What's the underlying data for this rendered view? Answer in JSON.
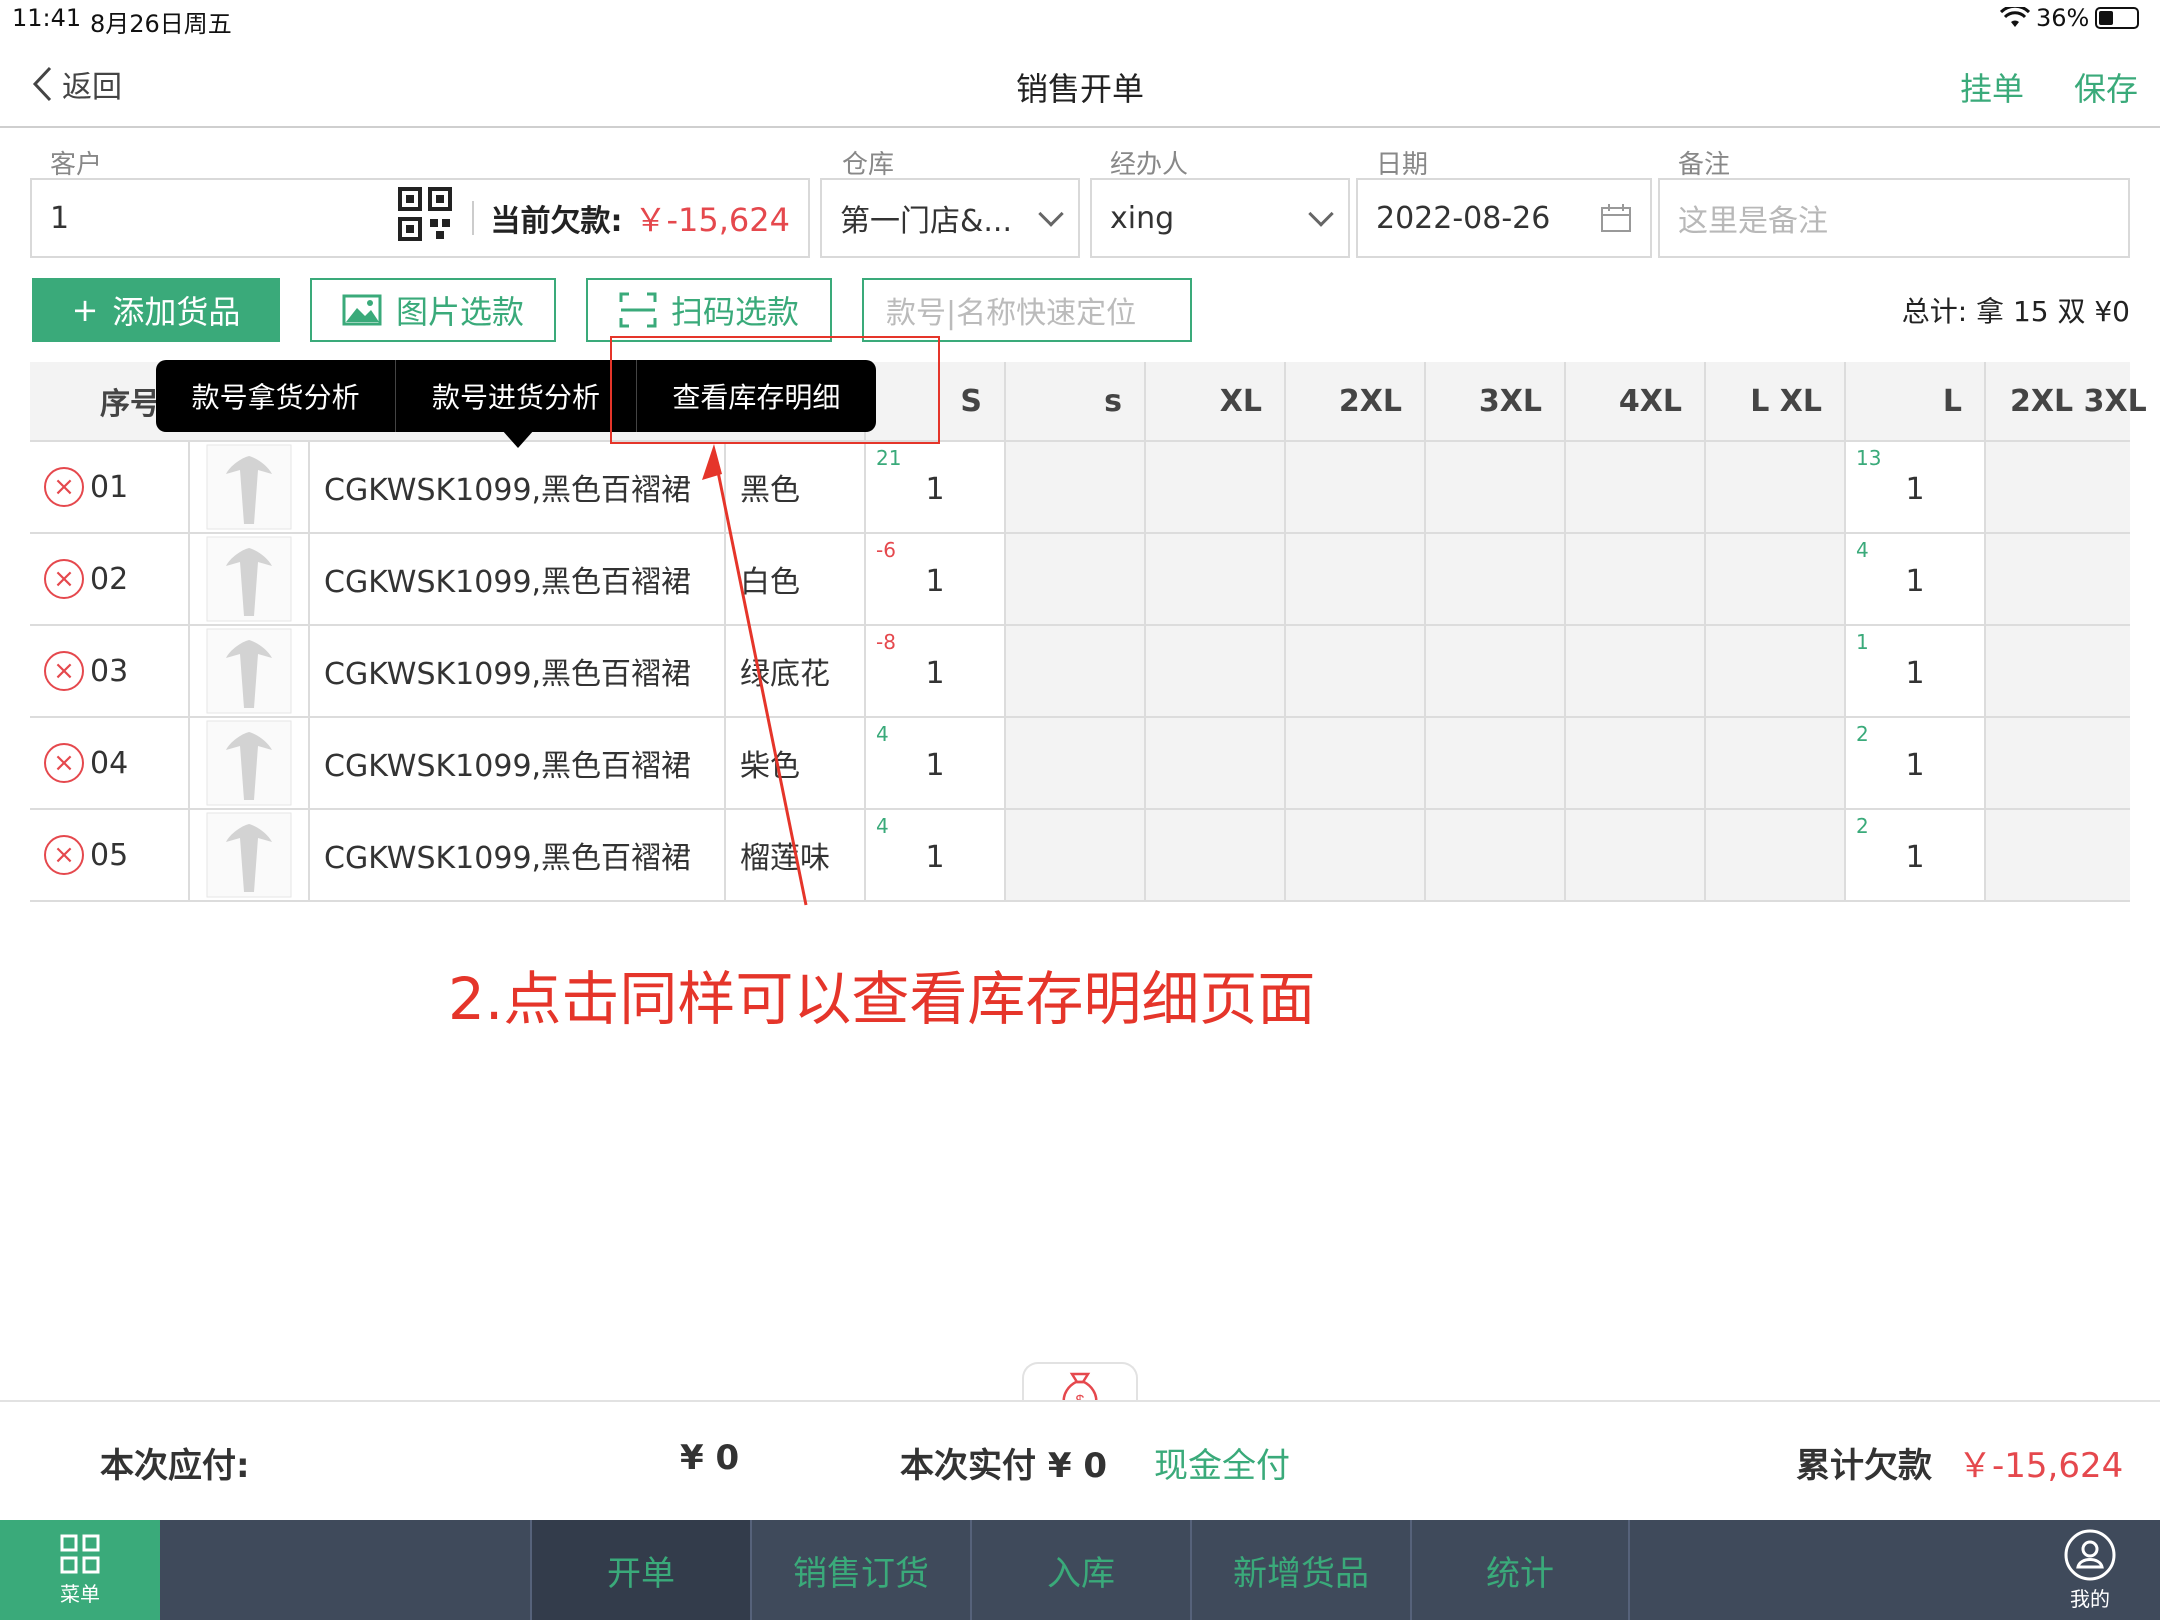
{
  "status_bar": {
    "time": "11:41",
    "date": "8月26日周五",
    "battery": "36%"
  },
  "nav": {
    "back_label": "返回",
    "title": "销售开单",
    "hold_label": "挂单",
    "save_label": "保存"
  },
  "form": {
    "customer_label": "客户",
    "customer_value": "1",
    "debt_label": "当前欠款:",
    "debt_value": "￥-15,624",
    "warehouse_label": "仓库",
    "warehouse_value": "第一门店&...",
    "handler_label": "经办人",
    "handler_value": "xing",
    "date_label": "日期",
    "date_value": "2022-08-26",
    "remark_label": "备注",
    "remark_placeholder": "这里是备注"
  },
  "actions": {
    "add_goods": "添加货品",
    "image_select": "图片选款",
    "scan_select": "扫码选款",
    "search_placeholder": "款号|名称快速定位",
    "total": "总计: 拿 15 双 ¥0"
  },
  "popover": {
    "items": [
      "款号拿货分析",
      "款号进货分析",
      "查看库存明细"
    ]
  },
  "table": {
    "headers": {
      "seq": "序号",
      "sizes": [
        "S",
        "s",
        "XL",
        "2XL",
        "3XL",
        "4XL",
        "L XL",
        "L",
        "2XL 3XL"
      ]
    },
    "rows": [
      {
        "seq": "01",
        "name": "CGKWSK1099,黑色百褶裙",
        "color": "黑色",
        "s_stock": "21",
        "s_qty": "1",
        "l_stock": "13",
        "l_qty": "1"
      },
      {
        "seq": "02",
        "name": "CGKWSK1099,黑色百褶裙",
        "color": "白色",
        "s_stock": "-6",
        "s_qty": "1",
        "l_stock": "4",
        "l_qty": "1"
      },
      {
        "seq": "03",
        "name": "CGKWSK1099,黑色百褶裙",
        "color": "绿底花",
        "s_stock": "-8",
        "s_qty": "1",
        "l_stock": "1",
        "l_qty": "1"
      },
      {
        "seq": "04",
        "name": "CGKWSK1099,黑色百褶裙",
        "color": "柴色",
        "s_stock": "4",
        "s_qty": "1",
        "l_stock": "2",
        "l_qty": "1"
      },
      {
        "seq": "05",
        "name": "CGKWSK1099,黑色百褶裙",
        "color": "榴莲味",
        "s_stock": "4",
        "s_qty": "1",
        "l_stock": "2",
        "l_qty": "1"
      }
    ]
  },
  "annotation": {
    "text": "2.点击同样可以查看库存明细页面"
  },
  "summary": {
    "payable_label": "本次应付:",
    "payable_value": "¥ 0",
    "paid_label": "本次实付 ¥ 0",
    "cash_full_label": "现金全付",
    "total_debt_label": "累计欠款",
    "total_debt_value": "￥-15,624"
  },
  "tabbar": {
    "menu_label": "菜单",
    "tabs": [
      "开单",
      "销售订货",
      "入库",
      "新增货品",
      "统计"
    ],
    "me_label": "我的"
  },
  "colors": {
    "accent": "#3aaa7a",
    "danger": "#e5484d",
    "tabbar_bg": "#3f4a5b"
  }
}
